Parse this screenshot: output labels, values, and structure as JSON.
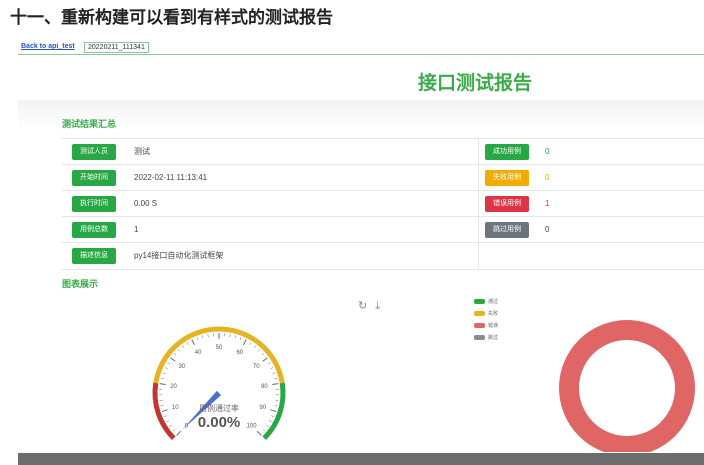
{
  "article": {
    "heading": "十一、重新构建可以看到有样式的测试报告"
  },
  "nav": {
    "back_link": "Back to api_test",
    "tab_label": "20220211_111341"
  },
  "report": {
    "title": "接口测试报告"
  },
  "summary": {
    "section_title": "测试结果汇总",
    "rows": [
      {
        "label": "测试人员",
        "value": "测试"
      },
      {
        "label": "开始时间",
        "value": "2022-02-11 11:13:41"
      },
      {
        "label": "执行时间",
        "value": "0.00 S"
      },
      {
        "label": "用例总数",
        "value": "1"
      },
      {
        "label": "描述信息",
        "value": "py14接口自动化测试框架"
      }
    ],
    "stats": [
      {
        "label": "成功用例",
        "value": "0",
        "color": "#28a745"
      },
      {
        "label": "失败用例",
        "value": "0",
        "color": "#f0ad00"
      },
      {
        "label": "错误用例",
        "value": "1",
        "color": "#dc3545"
      },
      {
        "label": "跳过用例",
        "value": "0",
        "color": "#6c757d"
      }
    ]
  },
  "charts": {
    "section_title": "图表展示",
    "toolbox": {
      "restore_icon": "restore-icon",
      "save_icon": "save-image-icon"
    },
    "legend": [
      {
        "label": "通过",
        "color": "#28a745"
      },
      {
        "label": "失败",
        "color": "#e6b422"
      },
      {
        "label": "错误",
        "color": "#e06666"
      },
      {
        "label": "跳过",
        "color": "#8c8c8c"
      }
    ],
    "gauge": {
      "label": "用例通过率",
      "value_text": "0.00%",
      "value": 0,
      "min": 0,
      "max": 100,
      "ticks": [
        "0",
        "10",
        "20",
        "30",
        "40",
        "50",
        "60",
        "70",
        "80",
        "90",
        "100"
      ],
      "colors": {
        "low": "#c23531",
        "mid": "#e6b422",
        "high": "#28a745",
        "pointer": "#4a6fd6"
      }
    },
    "donut": {
      "values": {
        "pass": 0,
        "fail": 0,
        "error": 1,
        "skip": 0
      },
      "color": "#e06666"
    }
  }
}
